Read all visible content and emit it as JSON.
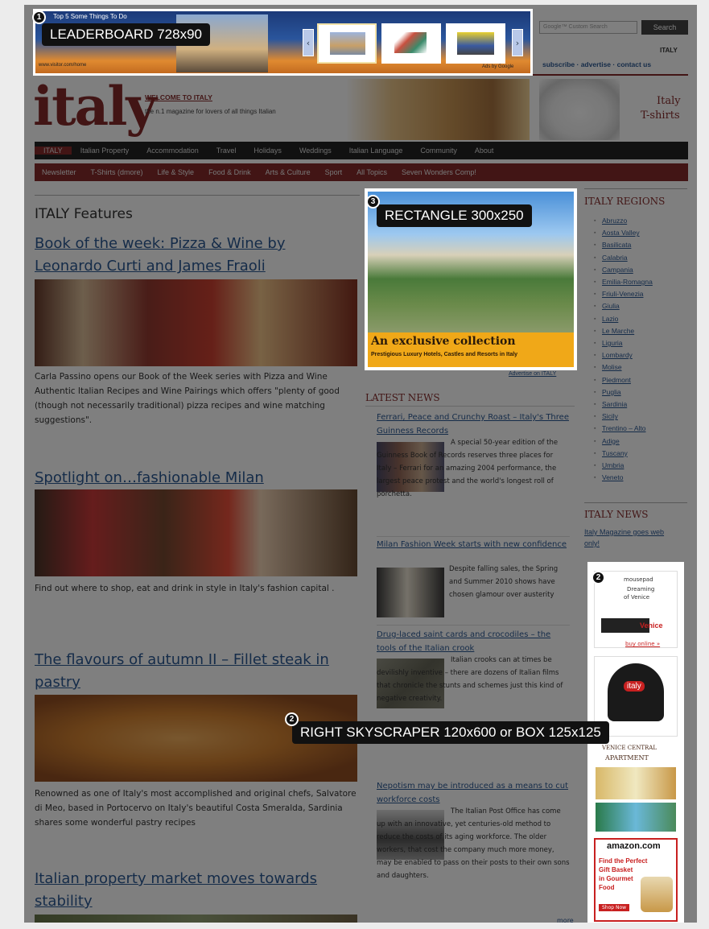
{
  "overlay_labels": {
    "leaderboard": "LEADERBOARD 728x90",
    "rectangle": "RECTANGLE 300x250",
    "skyscraper": "RIGHT SKYSCRAPER 120x600 or BOX 125x125",
    "num_1": "1",
    "num_2": "2",
    "num_3": "3",
    "num_2b": "2"
  },
  "leaderboard_ad": {
    "headline": "Top 5 Some Things To Do",
    "url": "www.visitor.com/home",
    "adchoices": "Ads by Google",
    "prev": "‹",
    "next": "›"
  },
  "header": {
    "search_placeholder": "Google™ Custom Search",
    "search_button": "Search",
    "country": "ITALY",
    "links": "subscribe · advertise · contact us",
    "logo": "italy",
    "welcome": "WELCOME TO ITALY",
    "tagline": "the n.1 magazine for lovers of all things Italian",
    "tshirt_line1": "Italy",
    "tshirt_line2": "T-shirts"
  },
  "nav": [
    "ITALY",
    "Italian Property",
    "Accommodation",
    "Travel",
    "Holidays",
    "Weddings",
    "Italian Language",
    "Community",
    "About"
  ],
  "subnav": [
    "Newsletter",
    "T-Shirts (dmore)",
    "Life & Style",
    "Food & Drink",
    "Arts & Culture",
    "Sport",
    "All Topics",
    "Seven Wonders Comp!"
  ],
  "features": {
    "heading": "ITALY Features",
    "items": [
      {
        "title": "Book of the week: Pizza & Wine by Leonardo Curti and James Fraoli",
        "desc": "Carla Passino opens our Book of the Week series with Pizza and Wine Authentic Italian Recipes and Wine Pairings which offers \"plenty of good (though not necessarily traditional) pizza recipes and wine matching suggestions\"."
      },
      {
        "title": "Spotlight on…fashionable Milan",
        "desc": "Find out where to shop, eat and drink in style in Italy's fashion capital ."
      },
      {
        "title": "The flavours of autumn II – Fillet steak in pastry",
        "desc": "Renowned as one of Italy's most accomplished and original chefs, Salvatore di Meo, based in Portocervo on Italy's beautiful Costa Smeralda, Sardinia shares some wonderful pastry recipes"
      },
      {
        "title": "Italian property market moves towards stability",
        "desc": ""
      }
    ]
  },
  "rect_ad": {
    "line1": "An exclusive collection",
    "line2": "Prestigious Luxury Hotels, Castles and Resorts in Italy",
    "advertise": "Advertise on ITALY"
  },
  "latest_news": {
    "heading": "LATEST NEWS",
    "items": [
      {
        "title": "Ferrari, Peace and Crunchy Roast – Italy's Three Guinness Records",
        "body": "A special 50-year edition of the Guinness Book of Records reserves three places for Italy – Ferrari for an amazing 2004 performance, the largest peace protest and the world's longest roll of porchetta."
      },
      {
        "title": "Milan Fashion Week starts with new confidence",
        "body": "Despite falling sales, the Spring and Summer 2010 shows have chosen glamour over austerity"
      },
      {
        "title": "Drug-laced saint cards and crocodiles – the tools of the Italian crook",
        "body": "Italian crooks can at times be devilishly inventive – there are dozens of Italian films that chronicle the stunts and schemes just this kind of negative creativity."
      },
      {
        "title": "Nepotism may be introduced as a means to cut workforce costs",
        "body": "The Italian Post Office has come up with an innovative, yet centuries-old method to reduce the costs of its aging workforce. The older workers, that cost the company much more money, may be enabled to pass on their posts to their own sons and daughters."
      }
    ],
    "more": "more"
  },
  "regions": {
    "heading": "ITALY REGIONS",
    "items": [
      "Abruzzo",
      "Aosta Valley",
      "Basilicata",
      "Calabria",
      "Campania",
      "Emilia-Romagna",
      "Friuli-Venezia",
      "Giulia",
      "Lazio",
      "Le Marche",
      "Liguria",
      "Lombardy",
      "Molise",
      "Piedmont",
      "Puglia",
      "Sardinia",
      "Sicily",
      "Trentino – Alto",
      "Adige",
      "Tuscany",
      "Umbria",
      "Veneto"
    ]
  },
  "italy_news": {
    "heading": "ITALY NEWS",
    "link": "Italy Magazine goes web only!"
  },
  "skyscraper": {
    "mousepad_1": "mousepad",
    "mousepad_2": "Dreaming",
    "mousepad_3": "of Venice",
    "mousepad_4": "Venice",
    "buy": "buy online »",
    "cap": "italy",
    "apt_1": "VENICE CENTRAL",
    "apt_2": "APARTMENT",
    "amazon": "amazon.com",
    "gift_1": "Find the Perfect",
    "gift_2": "Gift Basket",
    "gift_3": "in Gourmet",
    "gift_4": "Food",
    "shop": "Shop Now"
  },
  "colors": {
    "accent": "#7a1818",
    "link": "#1a4a8a",
    "nav": "#111111"
  }
}
